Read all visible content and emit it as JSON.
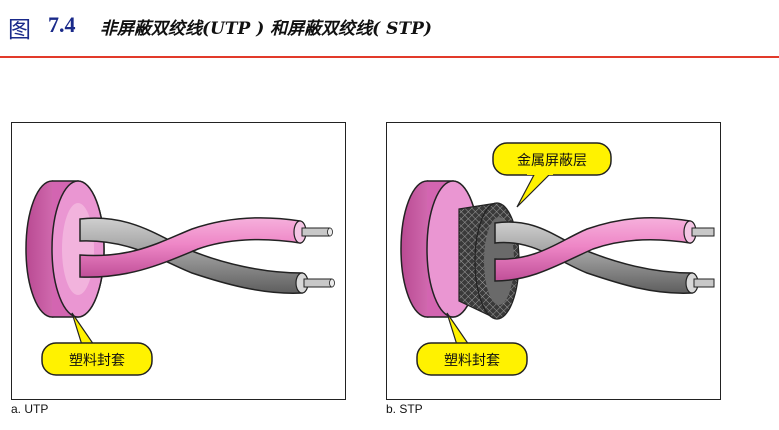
{
  "header": {
    "prefix": "图",
    "number": "7.4",
    "text": "非屏蔽双绞线(UTP ) 和屏蔽双绞线( STP)"
  },
  "panels": {
    "utp": {
      "jacket_label": "塑料封套",
      "caption": "a. UTP"
    },
    "stp": {
      "jacket_label": "塑料封套",
      "shield_label": "金属屏蔽层",
      "caption": "b. STP"
    }
  },
  "colors": {
    "title_blue": "#1a2a8a",
    "rule_red": "#e23a2a",
    "jacket_pink": "#e07ac4",
    "wire_pink": "#ef86c6",
    "wire_gray": "#8a8a8a",
    "callout_yellow": "#fff200"
  }
}
